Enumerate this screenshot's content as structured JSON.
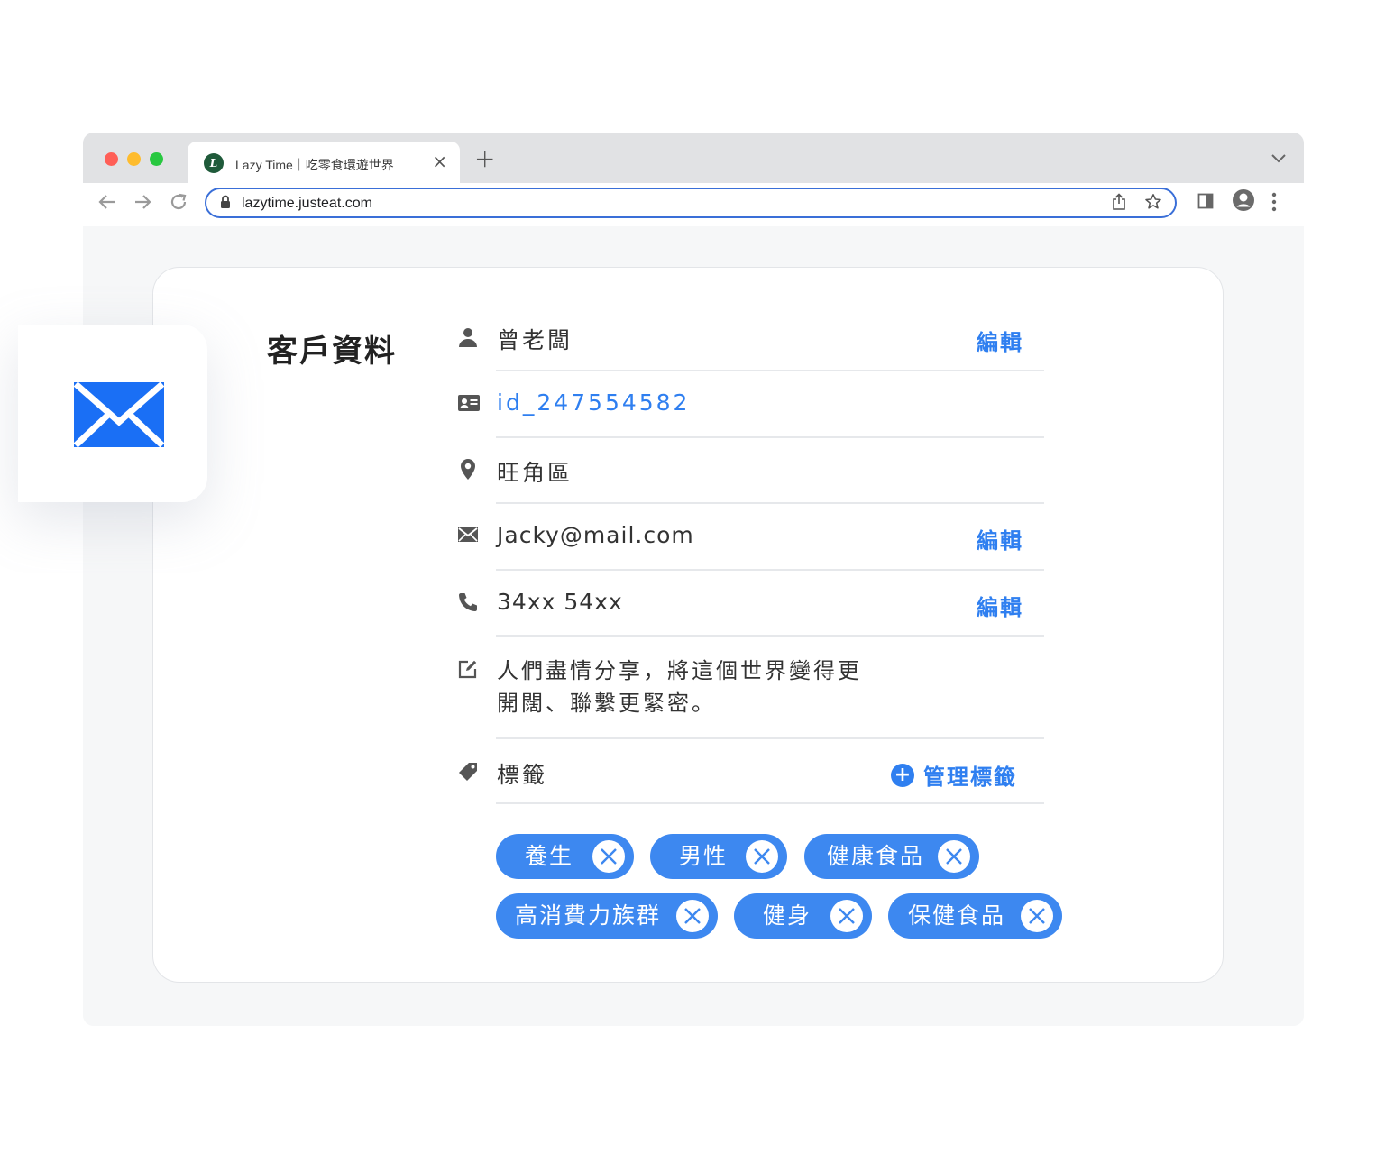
{
  "browser": {
    "tab_title": "Lazy Time｜吃零食環遊世界",
    "favicon_letter": "L",
    "url": "lazytime.justeat.com"
  },
  "icons": {
    "back": "arrow-left-icon",
    "forward": "arrow-right-icon",
    "reload": "reload-icon",
    "lock": "lock-icon",
    "share": "share-icon",
    "bookmark": "star-icon",
    "sidebar": "sidebar-icon",
    "profile": "profile-icon",
    "menu": "more-vertical-icon",
    "mail_tile": "envelope-icon"
  },
  "colors": {
    "accent": "#2f7ff0",
    "chip": "#3d88f0",
    "mail_icon": "#1a6ff5"
  },
  "profile": {
    "title": "客戶資料",
    "name": "曾老闆",
    "id": "id_247554582",
    "district": "旺角區",
    "email": "Jacky@mail.com",
    "phone": "34xx 54xx",
    "bio_line1": "人們盡情分享，將這個世界變得更",
    "bio_line2": "開闊、聯繫更緊密。",
    "tags_label": "標籤",
    "edit_label": "編輯",
    "manage_tags_label": "管理標籤",
    "tags": [
      "養生",
      "男性",
      "健康食品",
      "高消費力族群",
      "健身",
      "保健食品"
    ]
  }
}
